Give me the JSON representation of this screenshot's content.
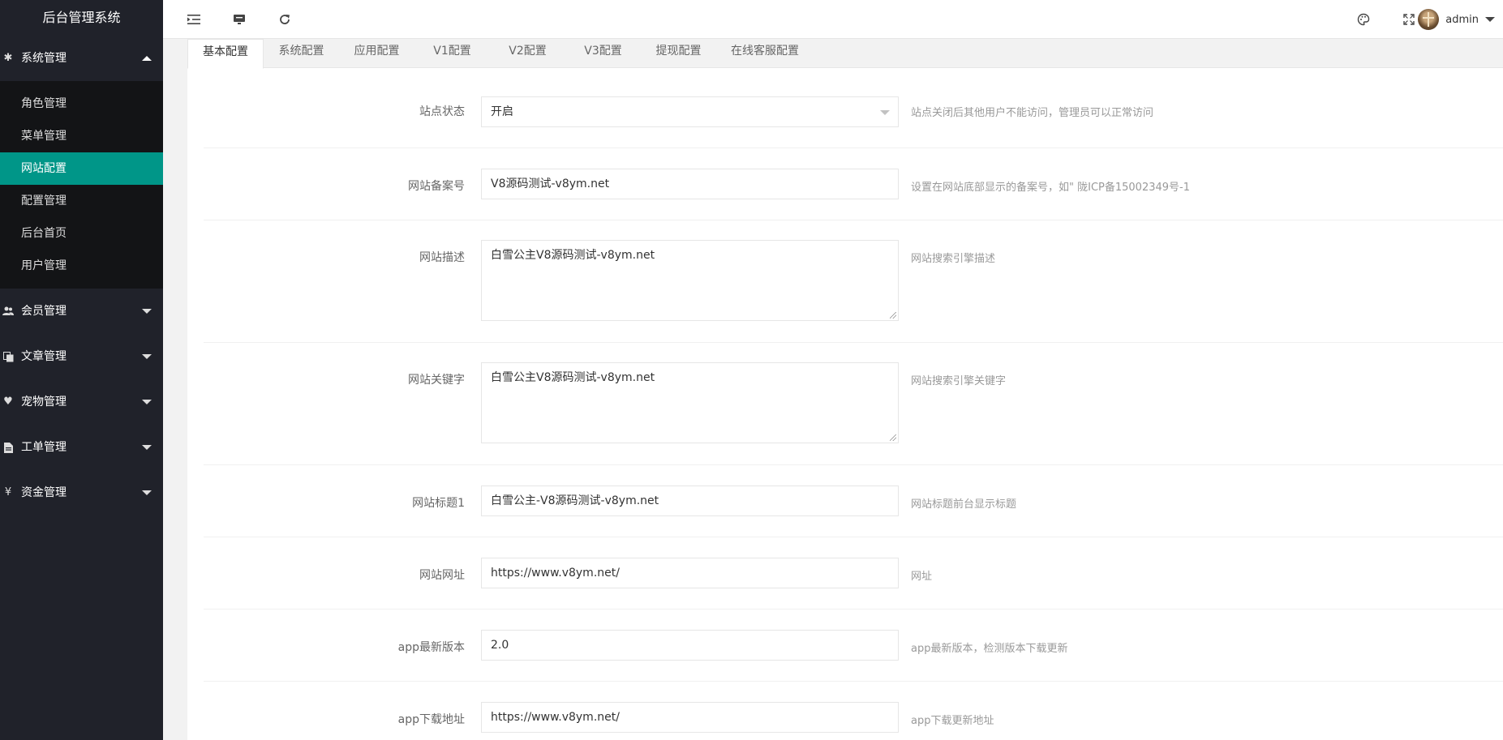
{
  "app": {
    "title": "后台管理系统"
  },
  "sidebar": {
    "groups": [
      {
        "label": "系统管理",
        "icon": "gear-icon",
        "items": [
          {
            "label": "角色管理"
          },
          {
            "label": "菜单管理"
          },
          {
            "label": "网站配置"
          },
          {
            "label": "配置管理"
          },
          {
            "label": "后台首页"
          },
          {
            "label": "用户管理"
          }
        ]
      },
      {
        "label": "会员管理",
        "icon": "users-icon"
      },
      {
        "label": "文章管理",
        "icon": "copy-icon"
      },
      {
        "label": "宠物管理",
        "icon": "heart-icon"
      },
      {
        "label": "工单管理",
        "icon": "document-icon"
      },
      {
        "label": "资金管理",
        "icon": "yen-icon"
      }
    ],
    "active_item": "网站配置",
    "accent_color": "#009688"
  },
  "header": {
    "user": "admin",
    "icons": [
      "menu-toggle-icon",
      "monitor-icon",
      "refresh-icon",
      "theme-palette-icon",
      "fullscreen-icon"
    ]
  },
  "tabs": [
    {
      "label": "基本配置"
    },
    {
      "label": "系统配置"
    },
    {
      "label": "应用配置"
    },
    {
      "label": "V1配置"
    },
    {
      "label": "V2配置"
    },
    {
      "label": "V3配置"
    },
    {
      "label": "提现配置"
    },
    {
      "label": "在线客服配置"
    }
  ],
  "form": [
    {
      "label": "站点状态",
      "value": "开启",
      "tip": "站点关闭后其他用户不能访问，管理员可以正常访问"
    },
    {
      "label": "网站备案号",
      "value": "V8源码测试-v8ym.net",
      "tip": "设置在网站底部显示的备案号，如\" 陇ICP备15002349号-1"
    },
    {
      "label": "网站描述",
      "value": "白雪公主V8源码测试-v8ym.net",
      "tip": "网站搜索引擎描述"
    },
    {
      "label": "网站关键字",
      "value": "白雪公主V8源码测试-v8ym.net",
      "tip": "网站搜索引擎关键字"
    },
    {
      "label": "网站标题1",
      "value": "白雪公主-V8源码测试-v8ym.net",
      "tip": "网站标题前台显示标题"
    },
    {
      "label": "网站网址",
      "value": "https://www.v8ym.net/",
      "tip": "网址"
    },
    {
      "label": "app最新版本",
      "value": "2.0",
      "tip": "app最新版本，检测版本下载更新"
    },
    {
      "label": "app下载地址",
      "value": "https://www.v8ym.net/",
      "tip": "app下载更新地址"
    }
  ]
}
